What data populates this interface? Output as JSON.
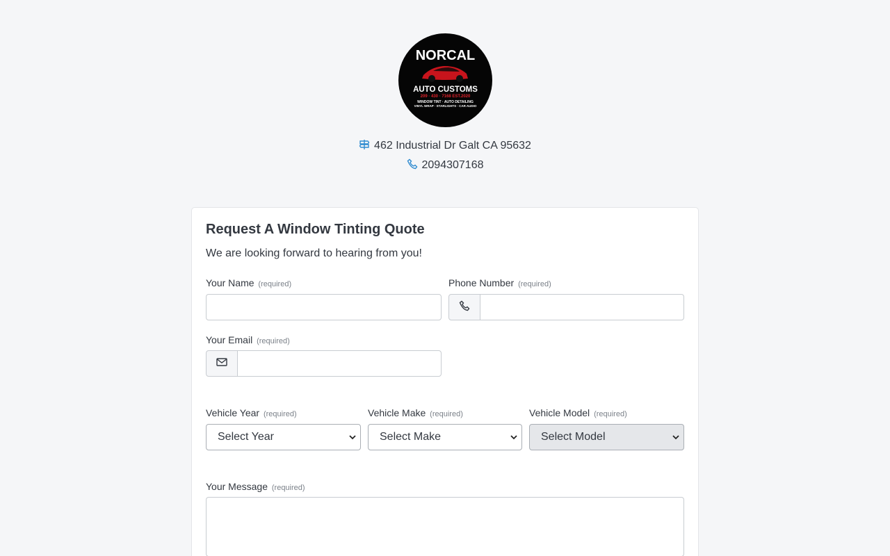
{
  "logo": {
    "line1": "NORCAL",
    "line2": "AUTO CUSTOMS",
    "phone_est": "209 · 430 · 7168  EST.2020",
    "services1": "WINDOW TINT · AUTO DETAILING",
    "services2": "VINYL WRAP · STARLIGHTS · CAR AUDIO"
  },
  "contact": {
    "address": "462 Industrial Dr Galt CA 95632",
    "phone": "2094307168",
    "address_icon": "signpost-icon",
    "phone_icon": "phone-icon"
  },
  "form": {
    "title": "Request A Window Tinting Quote",
    "subtitle": "We are looking forward to hearing from you!",
    "required_text": "(required)",
    "name_label": "Your Name",
    "phone_label": "Phone Number",
    "email_label": "Your Email",
    "year_label": "Vehicle Year",
    "make_label": "Vehicle Make",
    "model_label": "Vehicle Model",
    "message_label": "Your Message",
    "year_value": "Select Year",
    "make_value": "Select Make",
    "model_value": "Select Model"
  }
}
